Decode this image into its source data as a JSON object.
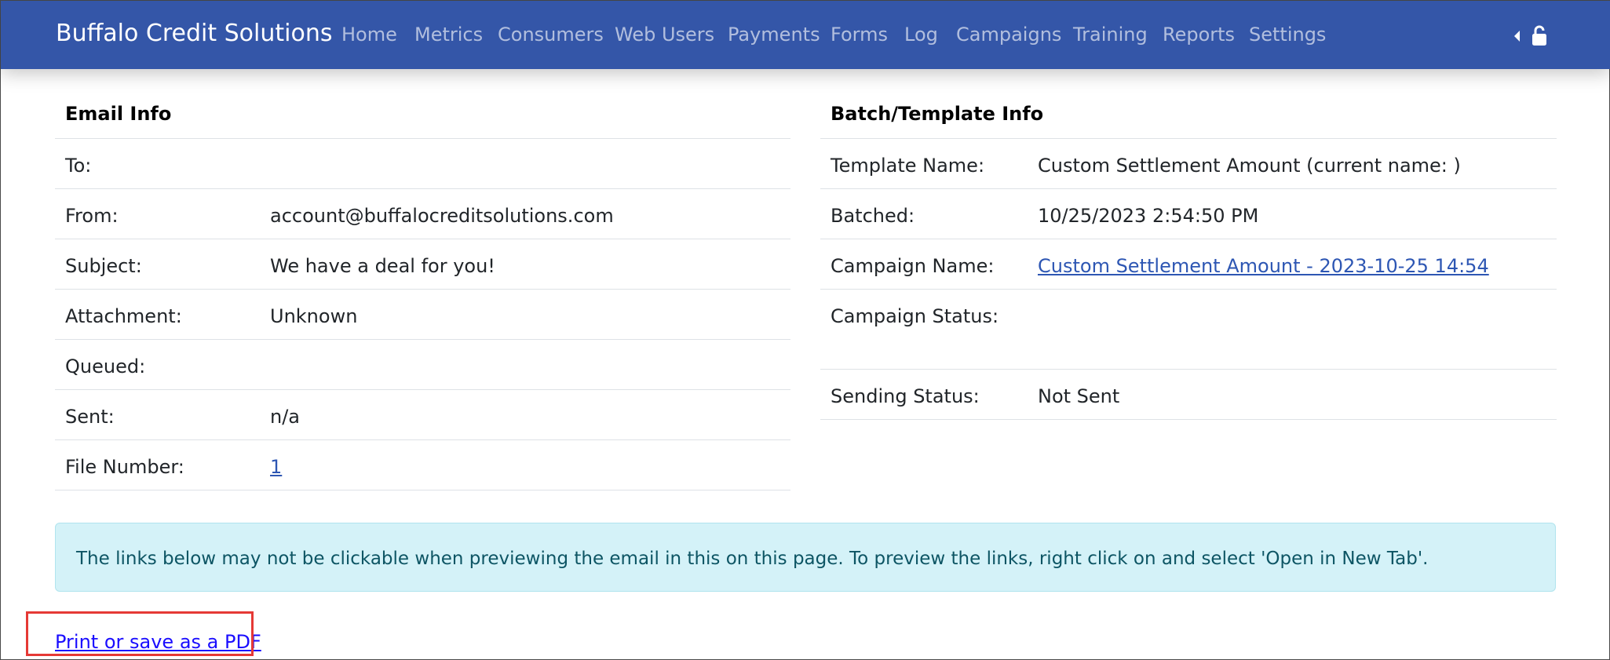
{
  "navbar": {
    "brand": "Buffalo Credit Solutions",
    "items": [
      "Home",
      "Metrics",
      "Consumers",
      "Web Users",
      "Payments",
      "Forms",
      "Log",
      "Campaigns",
      "Training",
      "Reports",
      "Settings"
    ],
    "icons": [
      "caret-left-icon",
      "lock-icon"
    ]
  },
  "email_info": {
    "title": "Email Info",
    "rows": [
      {
        "label": "To:",
        "value": ""
      },
      {
        "label": "From:",
        "value": "account@buffalocreditsolutions.com"
      },
      {
        "label": "Subject:",
        "value": "We have a deal for you!"
      },
      {
        "label": "Attachment:",
        "value": "Unknown"
      },
      {
        "label": "Queued:",
        "value": ""
      },
      {
        "label": "Sent:",
        "value": "n/a"
      },
      {
        "label": "File Number:",
        "value": "1"
      }
    ]
  },
  "batch_info": {
    "title": "Batch/Template Info",
    "rows": [
      {
        "label": "Template Name:",
        "value": "Custom Settlement Amount (current name: )"
      },
      {
        "label": "Batched:",
        "value": "10/25/2023 2:54:50 PM"
      },
      {
        "label": "Campaign Name:",
        "value": "Custom Settlement Amount - 2023-10-25 14:54"
      },
      {
        "label": "Campaign Status:",
        "value": ""
      },
      {
        "label": "Sending Status:",
        "value": "Not Sent"
      }
    ]
  },
  "alert": {
    "text": "The links below may not be clickable when previewing the email in this on this page. To preview the links, right click on and select 'Open in New Tab'."
  },
  "print_link": "Print or save as a PDF",
  "colors": {
    "navbar": "#3456a8",
    "link": "#2d56b3",
    "alert_bg": "#d4f2f8",
    "alert_text": "#0d5564",
    "highlight": "#e53935"
  }
}
